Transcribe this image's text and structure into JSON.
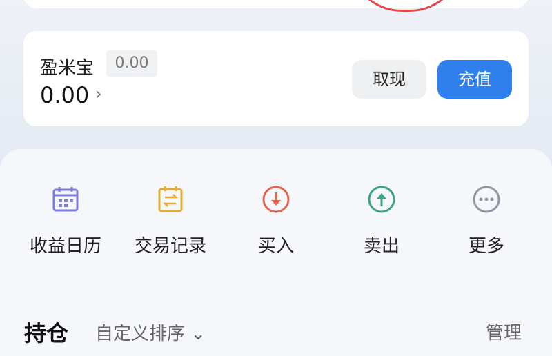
{
  "wallet": {
    "name": "盈米宝",
    "tag": "0.00",
    "balance": "0.00",
    "chevron": "›",
    "withdraw_label": "取现",
    "recharge_label": "充值"
  },
  "actions": [
    {
      "label": "收益日历",
      "icon": "calendar-icon",
      "color": "#7d7ad9"
    },
    {
      "label": "交易记录",
      "icon": "transaction-record-icon",
      "color": "#e6ad2d"
    },
    {
      "label": "买入",
      "icon": "buy-icon",
      "color": "#e4644d"
    },
    {
      "label": "卖出",
      "icon": "sell-icon",
      "color": "#3aa57f"
    },
    {
      "label": "更多",
      "icon": "more-icon",
      "color": "#8f96a3"
    }
  ],
  "holdings": {
    "title": "持仓",
    "sort_label": "自定义排序 ⌄",
    "manage_label": "管理"
  },
  "colors": {
    "accent": "#2f80ed",
    "circle_mark": "#e24a4a"
  }
}
